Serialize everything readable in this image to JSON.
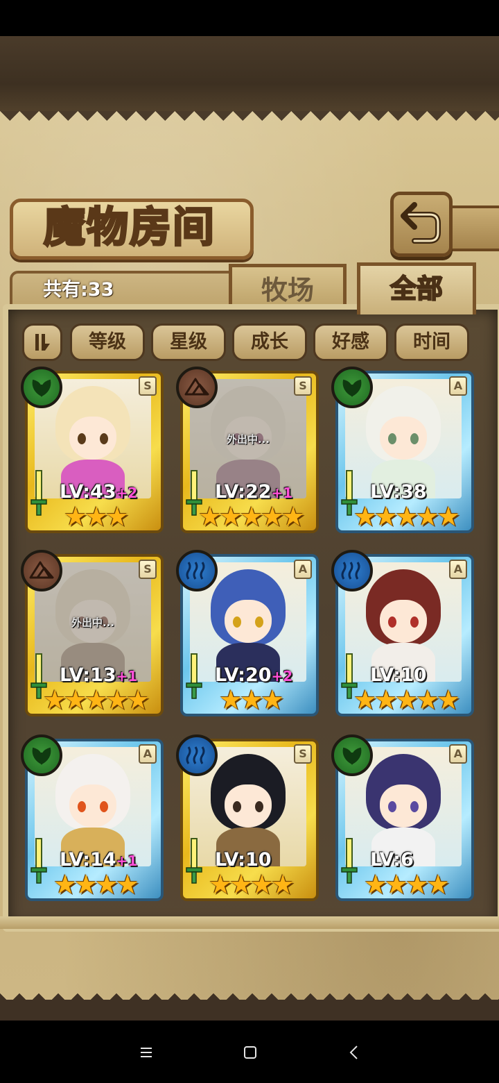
{
  "title": "魔物房间",
  "count_label": "共有:33",
  "tabs": [
    {
      "label": "牧场",
      "active": false
    },
    {
      "label": "全部",
      "active": true
    }
  ],
  "filters": [
    "等级",
    "星级",
    "成长",
    "好感",
    "时间"
  ],
  "colors": {
    "leaf": "#2f8a2f",
    "earth": "#6b4430",
    "water": "#2265b5",
    "gold_frame": "#f0c828",
    "blue_frame": "#7fd0f0",
    "plus_text": "#ff4fd8",
    "star": "#ffb515"
  },
  "monsters": [
    {
      "element": "leaf-icon",
      "rank": "S",
      "frame": "gold",
      "level": "LV:43",
      "bonus": "+2",
      "stars": 3,
      "away": "",
      "hair": "#f4e3b8",
      "eyes": "#5a3b1a",
      "body": "#d95ec0"
    },
    {
      "element": "earth-icon",
      "rank": "S",
      "frame": "gold",
      "level": "LV:22",
      "bonus": "+1",
      "stars": 5,
      "away": "外出中...",
      "hair": "#e8ddc3",
      "eyes": "#c04a8a",
      "body": "#c36e9e"
    },
    {
      "element": "leaf-icon",
      "rank": "A",
      "frame": "blue",
      "level": "LV:38",
      "bonus": "",
      "stars": 5,
      "away": "",
      "hair": "#f1f1ea",
      "eyes": "#6b8f6a",
      "body": "#e2efe0"
    },
    {
      "element": "earth-icon",
      "rank": "S",
      "frame": "gold",
      "level": "LV:13",
      "bonus": "+1",
      "stars": 5,
      "away": "外出中...",
      "hair": "#e8d6ab",
      "eyes": "#b04a3a",
      "body": "#b28a6a"
    },
    {
      "element": "water-icon",
      "rank": "A",
      "frame": "blue",
      "level": "LV:20",
      "bonus": "+2",
      "stars": 3,
      "away": "",
      "hair": "#3f5fb8",
      "eyes": "#d4a21a",
      "body": "#2b2f5c"
    },
    {
      "element": "water-icon",
      "rank": "A",
      "frame": "blue",
      "level": "LV:10",
      "bonus": "",
      "stars": 5,
      "away": "",
      "hair": "#7a2a24",
      "eyes": "#b0302a",
      "body": "#f2eee9"
    },
    {
      "element": "leaf-icon",
      "rank": "A",
      "frame": "blue",
      "level": "LV:14",
      "bonus": "+1",
      "stars": 4,
      "away": "",
      "hair": "#f4f1ee",
      "eyes": "#e0541c",
      "body": "#d8b05a"
    },
    {
      "element": "water-icon",
      "rank": "S",
      "frame": "gold",
      "level": "LV:10",
      "bonus": "",
      "stars": 4,
      "away": "",
      "hair": "#1b1c24",
      "eyes": "#3a2a20",
      "body": "#8a6a40"
    },
    {
      "element": "leaf-icon",
      "rank": "A",
      "frame": "blue",
      "level": "LV:6",
      "bonus": "",
      "stars": 4,
      "away": "",
      "hair": "#3a3470",
      "eyes": "#5a4aa0",
      "body": "#f2f2f2"
    }
  ],
  "nav": [
    "menu-icon",
    "home-icon",
    "back-icon"
  ]
}
